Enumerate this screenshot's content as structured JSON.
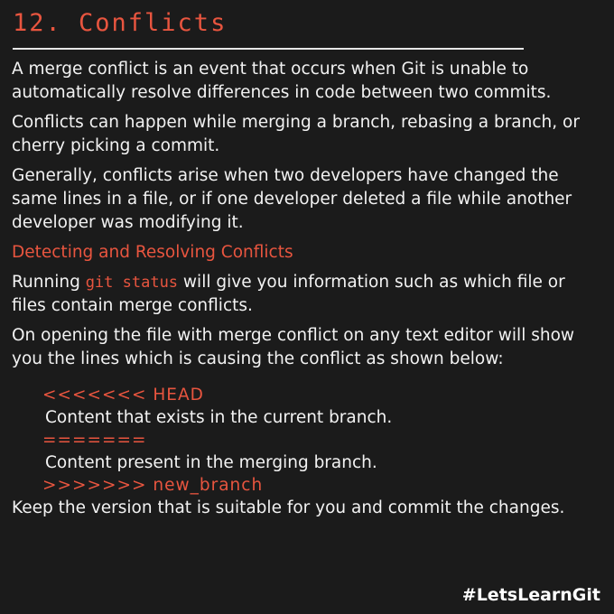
{
  "title": "12. Conflicts",
  "paragraphs": {
    "p1": "A merge conflict is an event that occurs when Git is unable to automatically resolve differences in code between two commits.",
    "p2": "Conflicts can happen while merging a branch, rebasing a branch, or cherry picking a commit.",
    "p3": "Generally, conflicts arise when two developers have changed the same lines in a file, or if one developer deleted a file while another developer was modifying it."
  },
  "section": {
    "heading": "Detecting and Resolving Conflicts",
    "running_prefix": "Running ",
    "running_command": "git status",
    "running_suffix": " will give you information such as which file or files contain merge conflicts.",
    "opening_text": "On opening the file with merge conflict on any text editor will show you the lines which is causing the conflict as shown below:"
  },
  "conflict_example": {
    "head_marker": "<<<<<<< HEAD",
    "current_content": "Content that exists in the current branch.",
    "separator": "=======",
    "merging_content": "Content present in the merging branch.",
    "branch_marker": ">>>>>>> new_branch"
  },
  "closing": "Keep the version that is suitable for you and commit the changes.",
  "hashtag": "#LetsLearnGit",
  "colors": {
    "background": "#1b1b1b",
    "accent": "#e8553f",
    "text": "#f2f2f2"
  }
}
